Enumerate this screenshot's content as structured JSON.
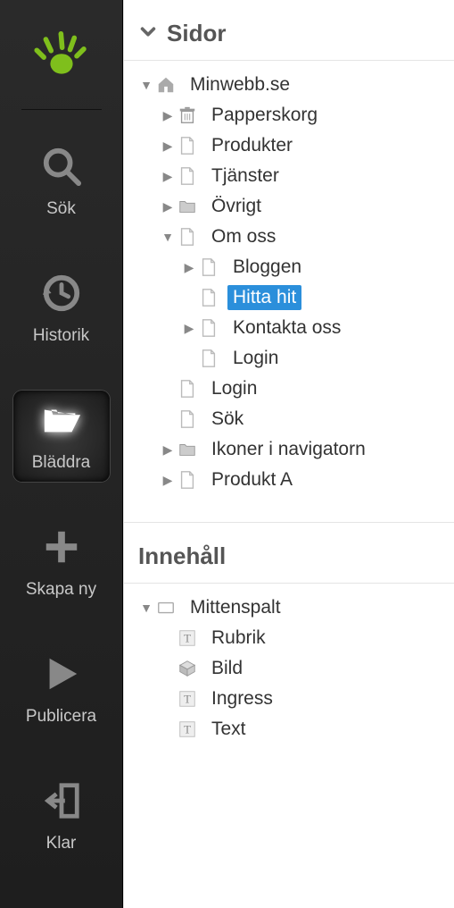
{
  "sidebar": {
    "items": [
      {
        "label": "Sök"
      },
      {
        "label": "Historik"
      },
      {
        "label": "Bläddra"
      },
      {
        "label": "Skapa ny"
      },
      {
        "label": "Publicera"
      },
      {
        "label": "Klar"
      }
    ]
  },
  "pages": {
    "header": "Sidor",
    "tree": {
      "root": "Minwebb.se",
      "items": [
        {
          "label": "Papperskorg"
        },
        {
          "label": "Produkter"
        },
        {
          "label": "Tjänster"
        },
        {
          "label": "Övrigt"
        },
        {
          "label": "Om oss",
          "children": [
            {
              "label": "Bloggen"
            },
            {
              "label": "Hitta hit"
            },
            {
              "label": "Kontakta oss"
            },
            {
              "label": "Login"
            }
          ]
        },
        {
          "label": "Login"
        },
        {
          "label": "Sök"
        },
        {
          "label": "Ikoner i navigatorn"
        },
        {
          "label": "Produkt A"
        }
      ]
    }
  },
  "content": {
    "header": "Innehåll",
    "root": "Mittenspalt",
    "items": [
      {
        "label": "Rubrik"
      },
      {
        "label": "Bild"
      },
      {
        "label": "Ingress"
      },
      {
        "label": "Text"
      }
    ]
  }
}
